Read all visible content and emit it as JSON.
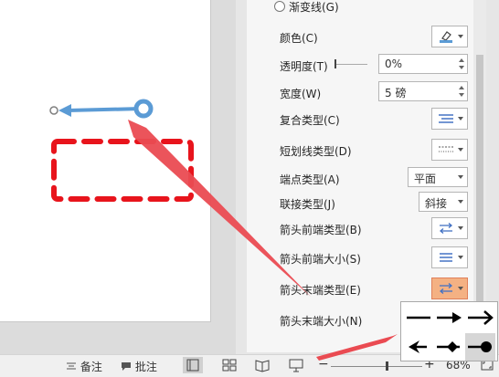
{
  "format_pane": {
    "gradient_line_label": "渐变线(G)",
    "color_label": "颜色(C)",
    "transparency_label": "透明度(T)",
    "transparency_value": "0%",
    "width_label": "宽度(W)",
    "width_value": "5 磅",
    "compound_type_label": "复合类型(C)",
    "dash_type_label": "短划线类型(D)",
    "cap_type_label": "端点类型(A)",
    "cap_type_value": "平面",
    "join_type_label": "联接类型(J)",
    "join_type_value": "斜接",
    "begin_arrow_type_label": "箭头前端类型(B)",
    "begin_arrow_size_label": "箭头前端大小(S)",
    "end_arrow_type_label": "箭头末端类型(E)",
    "end_arrow_size_label": "箭头末端大小(N)"
  },
  "status_bar": {
    "notes_label": "备注",
    "comments_label": "批注",
    "zoom_minus": "−",
    "zoom_plus": "+",
    "zoom_level": "68%"
  },
  "colors": {
    "line_blue": "#5b9bd5",
    "dash_red": "#e8141c",
    "annotation_red": "#ea4b52",
    "selected_dropdown": "#f4b183"
  },
  "icons": {
    "line_color": "pen-color-icon",
    "compound": "compound-lines-icon",
    "dash": "dash-lines-icon",
    "arrows": "arrow-type-icon",
    "arrow_size": "arrow-size-icon",
    "notes": "notes-icon",
    "comments": "comment-icon",
    "normal_view": "normal-view-icon",
    "slide_sorter": "slide-sorter-icon",
    "reading_view": "reading-view-icon",
    "slideshow": "slideshow-icon",
    "fit": "fit-to-window-icon"
  },
  "arrow_styles": [
    "none",
    "arrow",
    "open-arrow",
    "stealth-arrow",
    "diamond-arrow",
    "oval-arrow"
  ],
  "selected_arrow_style": "oval-arrow"
}
